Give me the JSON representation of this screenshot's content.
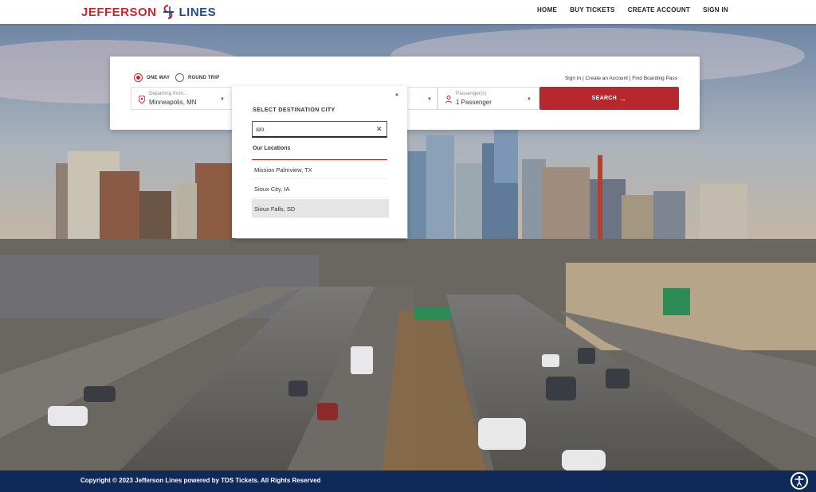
{
  "header": {
    "logo_part1": "JEFFERSON",
    "logo_part2": "LINES",
    "nav": [
      "HOME",
      "BUY TICKETS",
      "CREATE ACCOUNT",
      "SIGN IN"
    ]
  },
  "booking": {
    "one_way_label": "ONE WAY",
    "round_trip_label": "ROUND TRIP",
    "selected_trip": "one-way",
    "quick_links": "Sign In | Create an Account | Find Boarding Pass",
    "departing_label": "Departing from...",
    "departing_value": "Minneapolis, MN",
    "passenger_label": "Passenger(s)",
    "passenger_value": "1 Passenger",
    "search_label": "SEARCH"
  },
  "dropdown": {
    "title": "SELECT DESTINATION CITY",
    "input_value": "sio",
    "section_label": "Our Locations",
    "items": [
      "Mission Palmview, TX",
      "Sioux City, IA",
      "Sioux Falls, SD"
    ],
    "highlighted_index": 2
  },
  "footer": {
    "copyright": "Copyright © 2023 Jefferson Lines powered by TDS Tickets. All Rights Reserved"
  },
  "colors": {
    "brand_red": "#c8252b",
    "brand_blue": "#1d4d8f",
    "footer_navy": "#0f2a5a"
  }
}
